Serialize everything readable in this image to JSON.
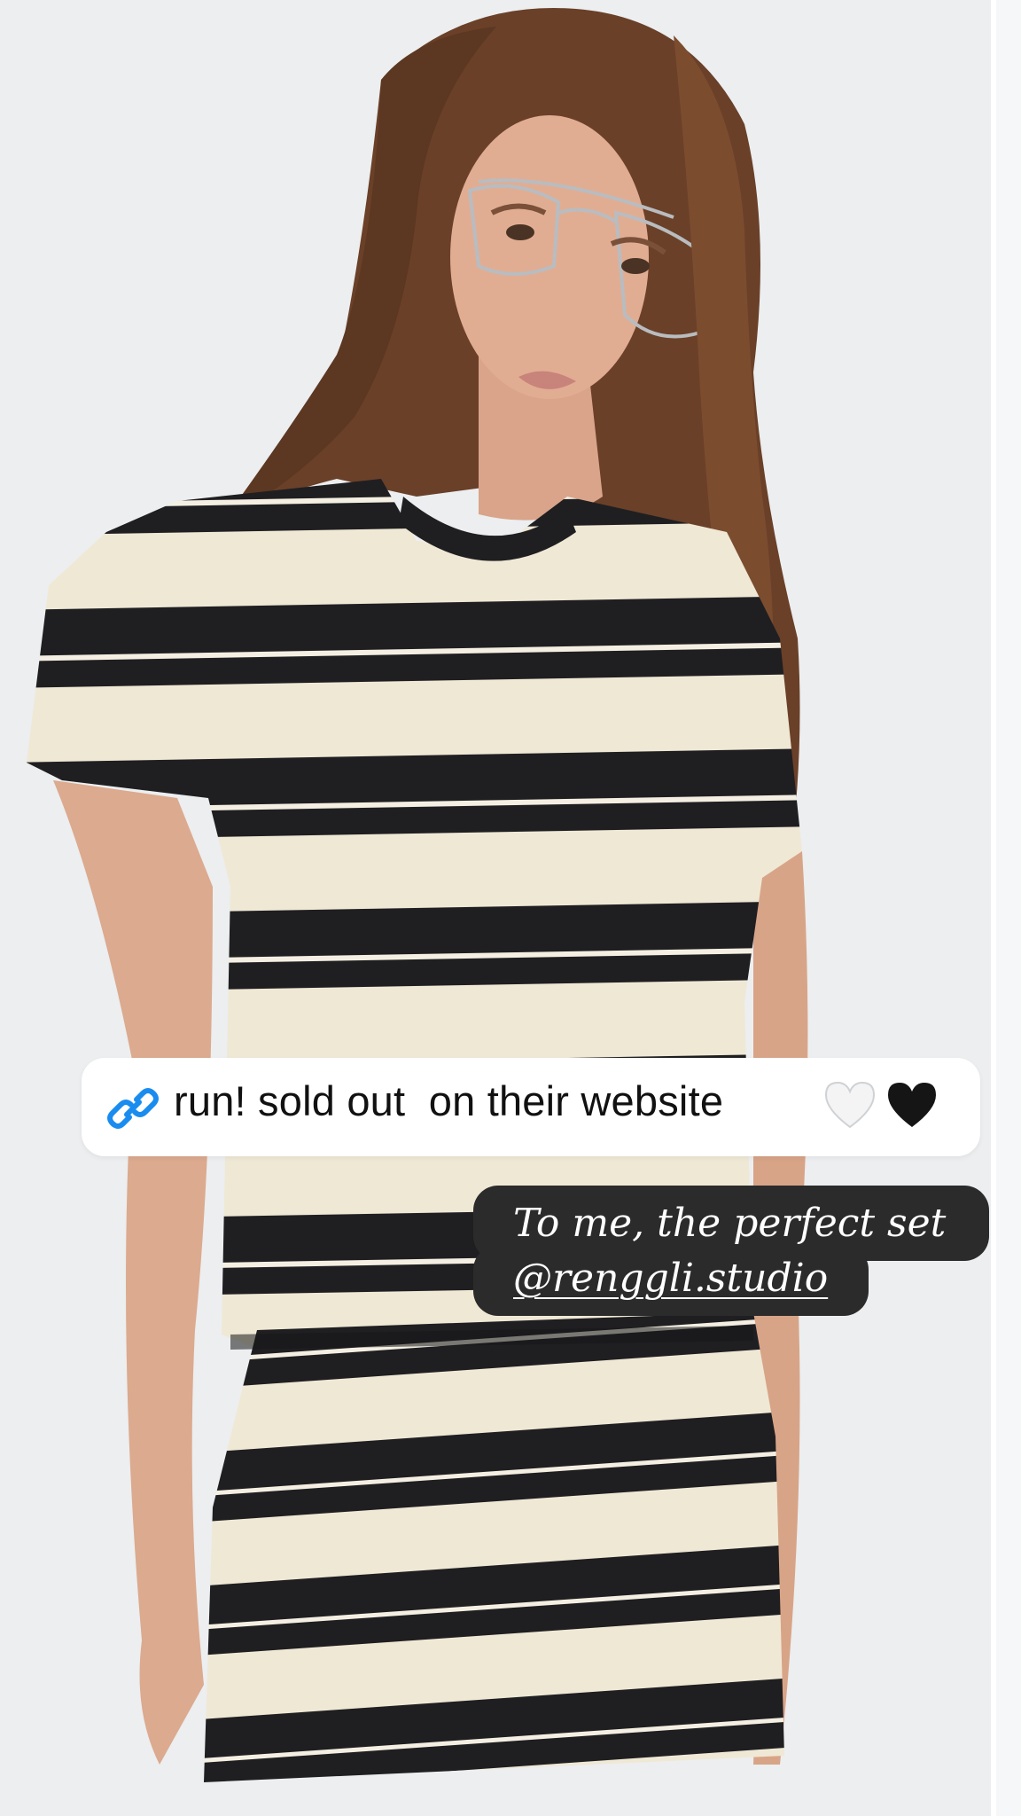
{
  "story": {
    "link_sticker": {
      "icon": "link-icon",
      "text": "run! sold out  on their website",
      "emojis": [
        "white-heart-icon",
        "black-heart-icon"
      ],
      "link_color": "#1a8cf0"
    },
    "caption": {
      "line1": "To me, the perfect set",
      "line2": "@renggli.studio"
    },
    "photo": {
      "subject": "model in black and cream striped tee and mini skirt",
      "background_color": "#eceef0",
      "stripe_dark": "#1f1f22",
      "stripe_light": "#efe8d5"
    }
  }
}
